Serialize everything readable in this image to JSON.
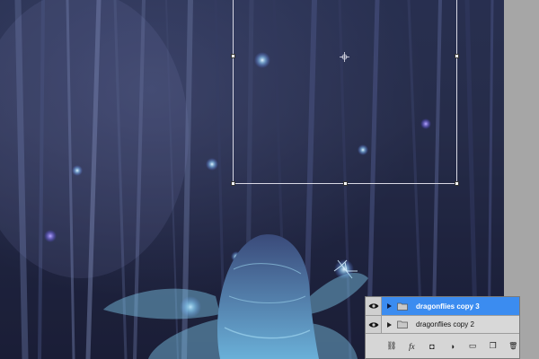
{
  "layers": [
    {
      "name": "dragonflies copy 3",
      "selected": true,
      "visible": true,
      "type": "group"
    },
    {
      "name": "dragonflies copy 2",
      "selected": false,
      "visible": true,
      "type": "group"
    }
  ],
  "footer_icons": [
    {
      "name": "link-layers-icon",
      "glyph": "⛓"
    },
    {
      "name": "fx-icon",
      "glyph": "fx"
    },
    {
      "name": "layer-mask-icon",
      "glyph": "◘"
    },
    {
      "name": "adjustment-layer-icon",
      "glyph": "◑"
    },
    {
      "name": "new-group-icon",
      "glyph": "▭"
    },
    {
      "name": "new-layer-icon",
      "glyph": "❐"
    },
    {
      "name": "trash-icon",
      "glyph": "🗑"
    }
  ],
  "colors": {
    "selected_row": "#3b8cf0",
    "panel_bg": "#d4d4d4",
    "canvas_dark": "#1f2440",
    "glow": "#9fd8ff"
  }
}
